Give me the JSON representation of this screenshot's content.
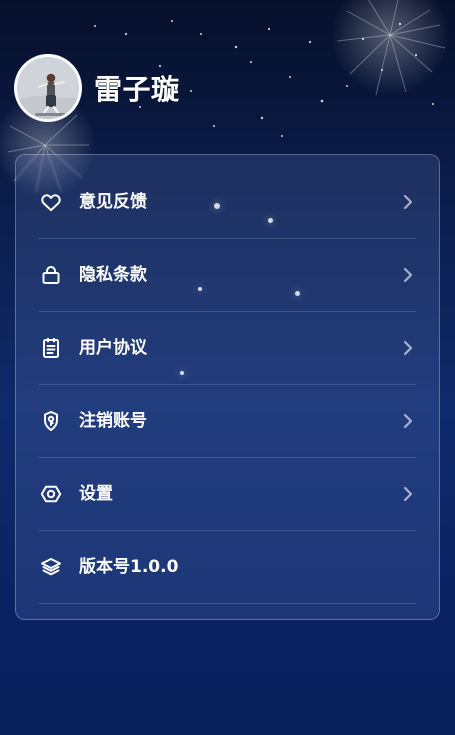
{
  "profile": {
    "username": "雷子璇"
  },
  "menu": {
    "items": [
      {
        "label": "意见反馈",
        "icon": "heart-icon",
        "has_chevron": true
      },
      {
        "label": "隐私条款",
        "icon": "lock-icon",
        "has_chevron": true
      },
      {
        "label": "用户协议",
        "icon": "document-icon",
        "has_chevron": true
      },
      {
        "label": "注销账号",
        "icon": "shield-key-icon",
        "has_chevron": true
      },
      {
        "label": "设置",
        "icon": "settings-icon",
        "has_chevron": true
      },
      {
        "label": "版本号1.0.0",
        "icon": "layers-icon",
        "has_chevron": false
      }
    ]
  }
}
